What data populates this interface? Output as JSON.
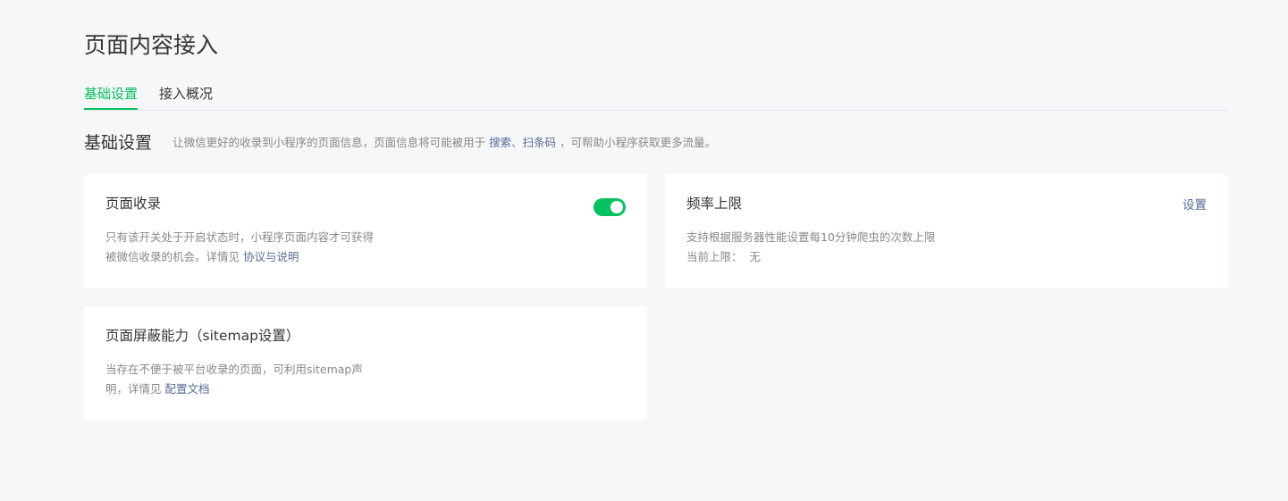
{
  "page": {
    "title": "页面内容接入"
  },
  "tabs": [
    {
      "label": "基础设置",
      "active": true
    },
    {
      "label": "接入概况",
      "active": false
    }
  ],
  "section": {
    "title": "基础设置",
    "desc_prefix": "让微信更好的收录到小程序的页面信息，页面信息将可能被用于",
    "link_search": "搜索",
    "separator": "、",
    "link_scan": "扫条码",
    "desc_suffix": "，可帮助小程序获取更多流量。"
  },
  "cards": {
    "page_index": {
      "title": "页面收录",
      "toggle_on": true,
      "desc_line1": "只有该开关处于开启状态时，小程序页面内容才可获得",
      "desc_line2_prefix": "被微信收录的机会。详情见",
      "desc_link": "协议与说明"
    },
    "rate_limit": {
      "title": "频率上限",
      "action": "设置",
      "desc_line1": "支持根据服务器性能设置每10分钟爬虫的次数上限",
      "current_label": "当前上限：",
      "current_value": "无"
    },
    "sitemap": {
      "title": "页面屏蔽能力（sitemap设置）",
      "desc_line1": "当存在不便于被平台收录的页面，可利用sitemap声",
      "desc_line2_prefix": "明，详情见",
      "desc_link": "配置文档"
    }
  },
  "colors": {
    "accent": "#07c160",
    "link": "#576b95",
    "background": "#f6f7f9"
  }
}
